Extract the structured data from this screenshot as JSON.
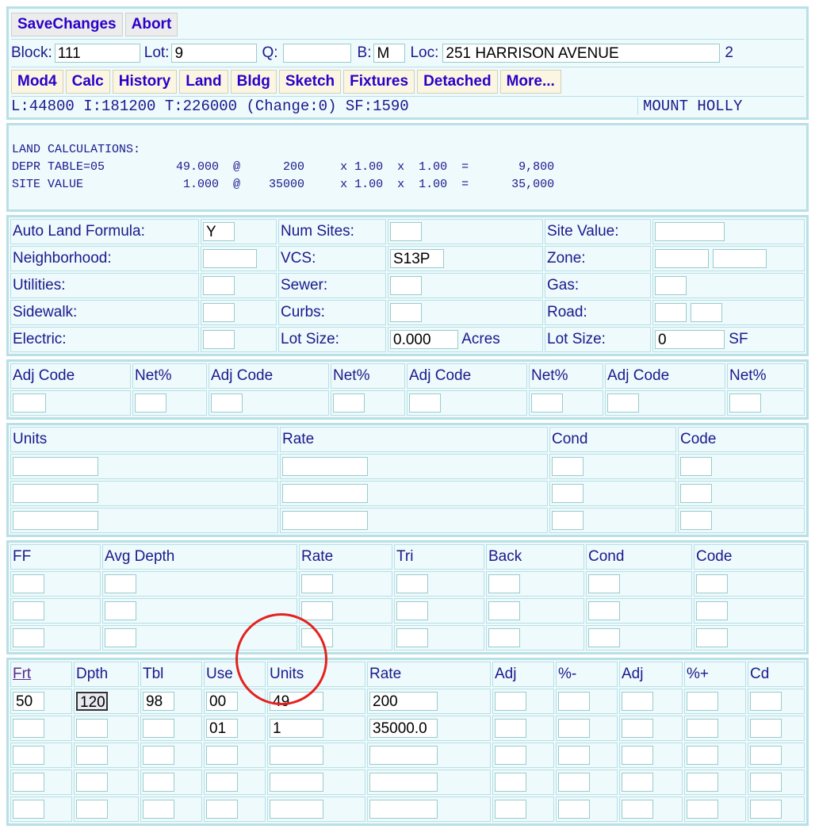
{
  "toolbar": {
    "save": "SaveChanges",
    "abort": "Abort"
  },
  "location": {
    "block_label": "Block:",
    "block": "111",
    "lot_label": "Lot:",
    "lot": "9",
    "q_label": "Q:",
    "q": "",
    "b_label": "B:",
    "b": "M",
    "loc_label": "Loc:",
    "loc": "251 HARRISON AVENUE",
    "card": "2"
  },
  "nav": [
    "Mod4",
    "Calc",
    "History",
    "Land",
    "Bldg",
    "Sketch",
    "Fixtures",
    "Detached",
    "More..."
  ],
  "summary": {
    "values": "L:44800 I:181200 T:226000 (Change:0) SF:1590",
    "town": "MOUNT HOLLY"
  },
  "calc": {
    "title": "LAND CALCULATIONS:",
    "lines": [
      "DEPR TABLE=05          49.000  @      200     x 1.00  x  1.00  =       9,800",
      "SITE VALUE              1.000  @    35000     x 1.00  x  1.00  =      35,000"
    ]
  },
  "land_attrs": {
    "auto_land_formula": {
      "label": "Auto Land Formula:",
      "value": "Y"
    },
    "num_sites": {
      "label": "Num Sites:",
      "value": ""
    },
    "site_value": {
      "label": "Site Value:",
      "value": ""
    },
    "neighborhood": {
      "label": "Neighborhood:",
      "value": ""
    },
    "vcs": {
      "label": "VCS:",
      "value": "S13P"
    },
    "zone": {
      "label": "Zone:",
      "value": ""
    },
    "utilities": {
      "label": "Utilities:",
      "value": ""
    },
    "sewer": {
      "label": "Sewer:",
      "value": ""
    },
    "gas": {
      "label": "Gas:",
      "value": ""
    },
    "sidewalk": {
      "label": "Sidewalk:",
      "value": ""
    },
    "curbs": {
      "label": "Curbs:",
      "value": ""
    },
    "road": {
      "label": "Road:",
      "value": ""
    },
    "electric": {
      "label": "Electric:",
      "value": ""
    },
    "lot_size_acres": {
      "label": "Lot Size:",
      "value": "0.000",
      "unit": "Acres"
    },
    "lot_size_sf": {
      "label": "Lot Size:",
      "value": "0",
      "unit": "SF"
    }
  },
  "adj": {
    "code_label": "Adj Code",
    "net_label": "Net%"
  },
  "units_table": {
    "headers": [
      "Units",
      "Rate",
      "Cond",
      "Code"
    ]
  },
  "ff_table": {
    "headers": [
      "FF",
      "Avg Depth",
      "Rate",
      "Tri",
      "Back",
      "Cond",
      "Code"
    ]
  },
  "land_table": {
    "headers": [
      "Frt",
      "Dpth",
      "Tbl",
      "Use",
      "Units",
      "Rate",
      "Adj",
      "%-",
      "Adj",
      "%+",
      "Cd"
    ],
    "rows": [
      [
        "50",
        "120",
        "98",
        "00",
        "49",
        "200",
        "",
        "",
        "",
        "",
        ""
      ],
      [
        "",
        "",
        "",
        "01",
        "1",
        "35000.0",
        "",
        "",
        "",
        "",
        ""
      ],
      [
        "",
        "",
        "",
        "",
        "",
        "",
        "",
        "",
        "",
        "",
        ""
      ],
      [
        "",
        "",
        "",
        "",
        "",
        "",
        "",
        "",
        "",
        "",
        ""
      ],
      [
        "",
        "",
        "",
        "",
        "",
        "",
        "",
        "",
        "",
        "",
        ""
      ]
    ]
  },
  "colors": {
    "panel": "#eefafc",
    "border": "#b8e0e6",
    "text": "#1a1a8c",
    "button_text": "#2b00c8",
    "annotation": "#e3221e"
  }
}
